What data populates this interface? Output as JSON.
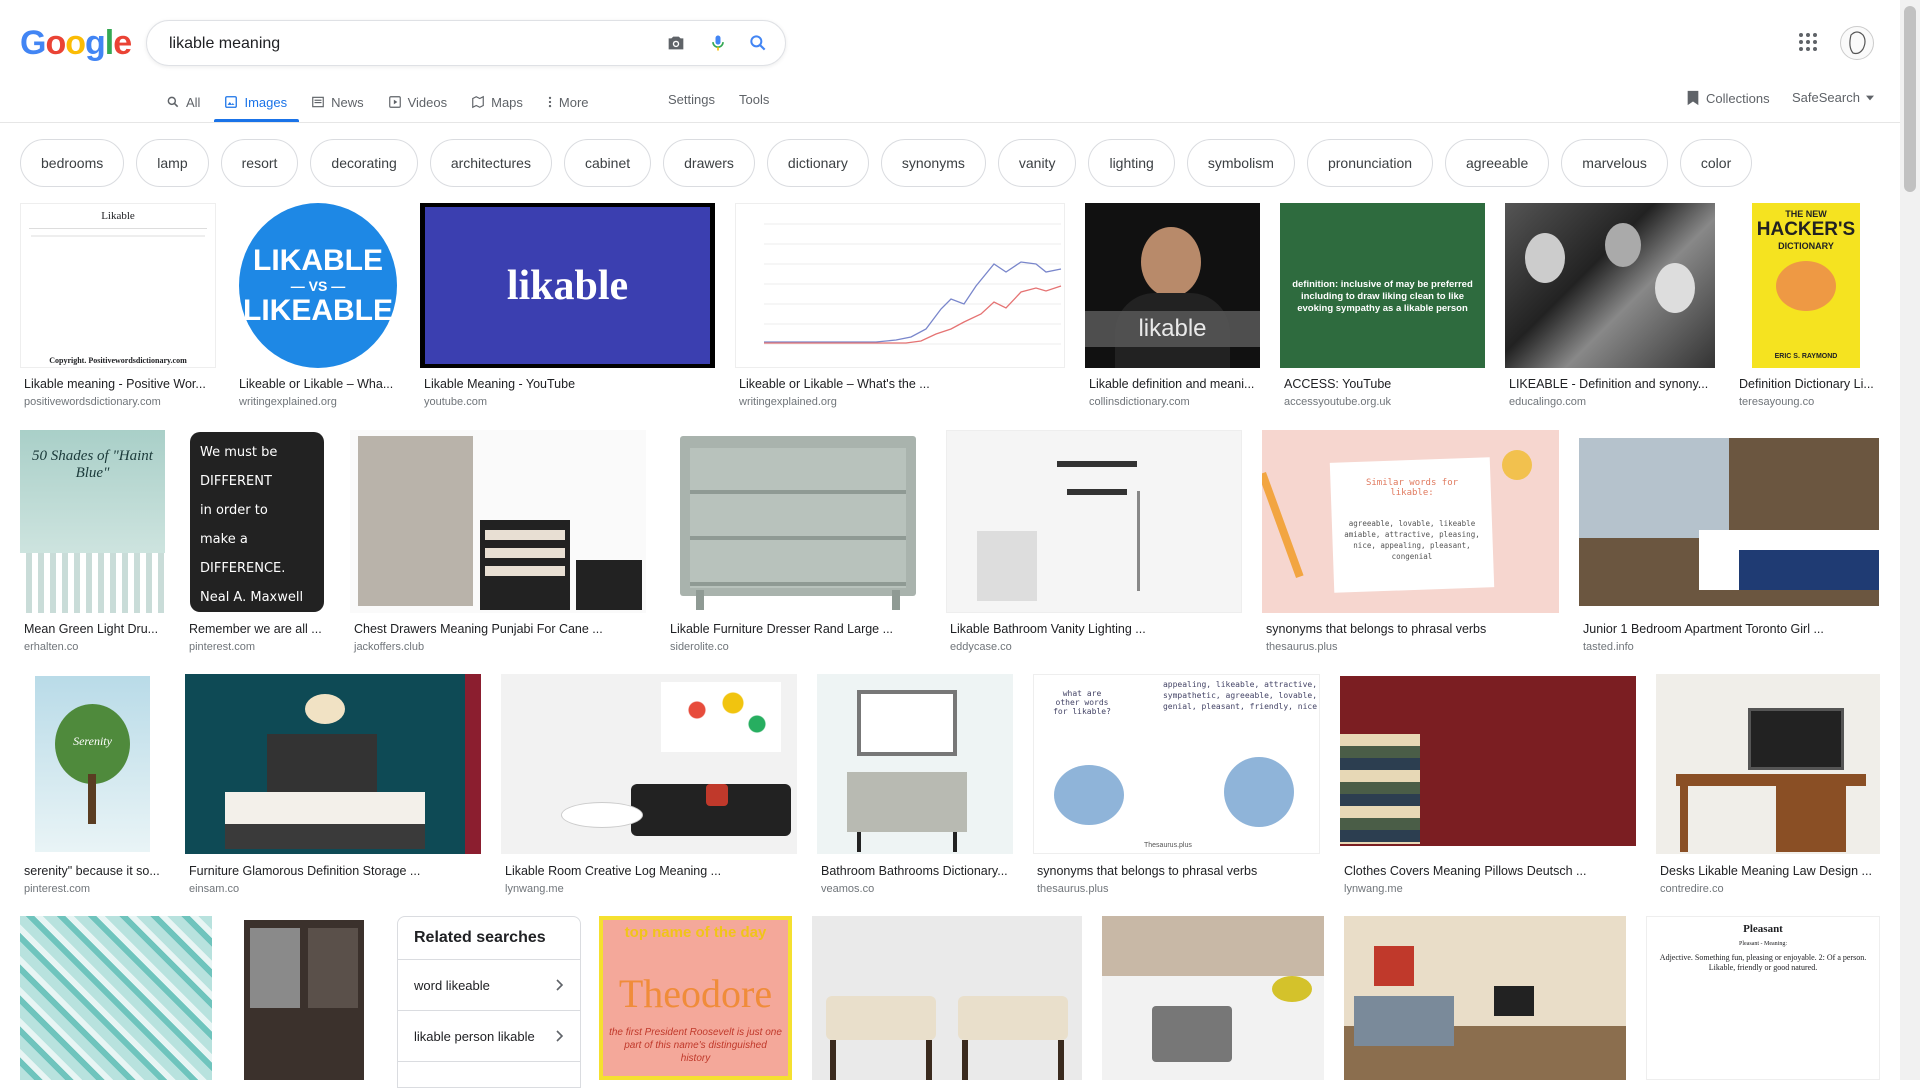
{
  "logo": {
    "letters": [
      "G",
      "o",
      "o",
      "g",
      "l",
      "e"
    ],
    "colors": [
      "#4285f4",
      "#ea4335",
      "#fbbc05",
      "#4285f4",
      "#34a853",
      "#ea4335"
    ]
  },
  "search": {
    "query": "likable meaning"
  },
  "tabs": [
    {
      "label": "All",
      "icon": "search-icon"
    },
    {
      "label": "Images",
      "icon": "image-icon"
    },
    {
      "label": "News",
      "icon": "newspaper-icon"
    },
    {
      "label": "Videos",
      "icon": "video-icon"
    },
    {
      "label": "Maps",
      "icon": "map-icon"
    },
    {
      "label": "More",
      "icon": "more-vertical-icon"
    }
  ],
  "settings_label": "Settings",
  "tools_label": "Tools",
  "collections_label": "Collections",
  "safesearch_label": "SafeSearch",
  "chips": [
    "bedrooms",
    "lamp",
    "resort",
    "decorating",
    "architectures",
    "cabinet",
    "drawers",
    "dictionary",
    "synonyms",
    "vanity",
    "lighting",
    "symbolism",
    "pronunciation",
    "agreeable",
    "marvelous",
    "color"
  ],
  "row1": [
    {
      "title": "Likable meaning - Positive Wor...",
      "source": "positivewordsdictionary.com",
      "heading": "Likable",
      "footer": "Copyright. Positivewordsdictionary.com"
    },
    {
      "title": "Likeable or Likable – Wha...",
      "source": "writingexplained.org",
      "text1": "LIKABLE",
      "text2": "— VS —",
      "text3": "LIKEABLE"
    },
    {
      "title": "Likable Meaning - YouTube",
      "source": "youtube.com",
      "text": "likable"
    },
    {
      "title": "Likeable or Likable – What's the ...",
      "source": "writingexplained.org"
    },
    {
      "title": "Likable definition and meani...",
      "source": "collinsdictionary.com",
      "text": "likable"
    },
    {
      "title": "ACCESS: YouTube",
      "source": "accessyoutube.org.uk",
      "text": "definition: inclusive of may be preferred including to draw liking clean to like evoking sympathy as a likable person"
    },
    {
      "title": "LIKEABLE - Definition and synony...",
      "source": "educalingo.com"
    },
    {
      "title": "Definition Dictionary Li...",
      "source": "teresayoung.co",
      "text1": "THE NEW",
      "text2": "HACKER'S",
      "text3": "DICTIONARY",
      "text4": "ERIC S. RAYMOND"
    }
  ],
  "row2": [
    {
      "title": "Mean Green Light Dru...",
      "source": "erhalten.co",
      "text": "50 Shades of \"Haint Blue\""
    },
    {
      "title": "Remember we are all ...",
      "source": "pinterest.com",
      "lines": [
        "We must be",
        "DIFFERENT",
        "in order to",
        "make a",
        "DIFFERENCE.",
        "Neal A. Maxwell"
      ]
    },
    {
      "title": "Chest Drawers Meaning Punjabi For Cane ...",
      "source": "jackoffers.club"
    },
    {
      "title": "Likable Furniture Dresser Rand Large ...",
      "source": "siderolite.co"
    },
    {
      "title": "Likable Bathroom Vanity Lighting ...",
      "source": "eddycase.co"
    },
    {
      "title": "synonyms that belongs to phrasal verbs",
      "source": "thesaurus.plus",
      "heading": "Similar words for likable:",
      "body": "agreeable, lovable, likeable amiable, attractive, pleasing, nice, appealing, pleasant, congenial"
    },
    {
      "title": "Junior 1 Bedroom Apartment Toronto Girl ...",
      "source": "tasted.info"
    }
  ],
  "row3": [
    {
      "title": "serenity\" because it so...",
      "source": "pinterest.com",
      "text1": "Serenity"
    },
    {
      "title": "Furniture Glamorous Definition Storage ...",
      "source": "einsam.co"
    },
    {
      "title": "Likable Room Creative Log Meaning ...",
      "source": "lynwang.me"
    },
    {
      "title": "Bathroom Bathrooms Dictionary...",
      "source": "veamos.co"
    },
    {
      "title": "synonyms that belongs to phrasal verbs",
      "source": "thesaurus.plus",
      "q": "what are other words for likable?",
      "a": "appealing, likeable, attractive, sympathetic, agreeable, lovable, genial, pleasant, friendly, nice",
      "brand": "Thesaurus.plus"
    },
    {
      "title": "Clothes Covers Meaning Pillows Deutsch ...",
      "source": "lynwang.me"
    },
    {
      "title": "Desks Likable Meaning Law Design ...",
      "source": "contredire.co"
    }
  ],
  "related": {
    "title": "Related searches",
    "items": [
      "word likeable",
      "likable person likable"
    ]
  },
  "row4": {
    "name_day": {
      "top": "top name of the day",
      "name": "Theodore",
      "caption": "the first President Roosevelt is just one part of this name's distinguished history"
    },
    "pleasant": {
      "heading": "Pleasant",
      "sub": "Pleasant - Meaning:",
      "body": "Adjective. Something fun, pleasing or enjoyable. 2: Of a person. Likable, friendly or good natured."
    }
  }
}
